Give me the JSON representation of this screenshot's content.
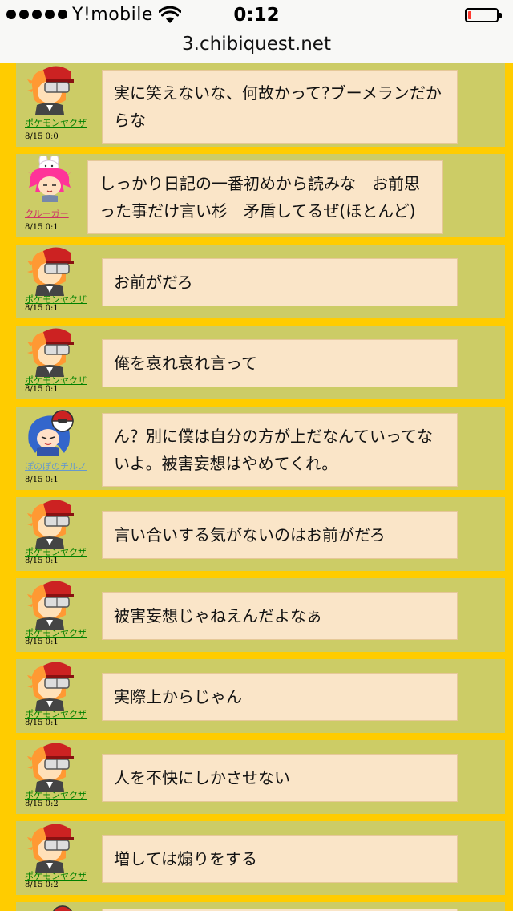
{
  "status_bar": {
    "carrier": "Y!mobile",
    "time": "0:12",
    "battery_level": 0.12,
    "battery_color": "#ff3a30"
  },
  "url_bar": {
    "url": "3.chibiquest.net"
  },
  "theme": {
    "page_bg": "#ffcc00",
    "row_bg": "#cccc66",
    "bubble_bg": "#fae5c8"
  },
  "messages": [
    {
      "user": "ポケモンヤクザ",
      "user_color": "#008000",
      "time": "8/15 0:0",
      "text": "実に笑えないな、何故かって?ブーメランだからな",
      "avatar": "pokemon-yakuza-avatar-icon"
    },
    {
      "user": "クルーガー",
      "user_color": "#cc3366",
      "time": "8/15 0:1",
      "text": "しっかり日記の一番初めから読みな　お前思った事だけ言い杉　矛盾してるぜ(ほとんど)",
      "avatar": "kruger-avatar-icon"
    },
    {
      "user": "ポケモンヤクザ",
      "user_color": "#008000",
      "time": "8/15 0:1",
      "text": "お前がだろ",
      "avatar": "pokemon-yakuza-avatar-icon"
    },
    {
      "user": "ポケモンヤクザ",
      "user_color": "#008000",
      "time": "8/15 0:1",
      "text": "俺を哀れ哀れ言って",
      "avatar": "pokemon-yakuza-avatar-icon"
    },
    {
      "user": "ぽのぽのチルノ",
      "user_color": "#6699cc",
      "time": "8/15 0:1",
      "text": "ん？別に僕は自分の方が上だなんていってないよ。被害妄想はやめてくれ。",
      "avatar": "cirno-avatar-icon"
    },
    {
      "user": "ポケモンヤクザ",
      "user_color": "#008000",
      "time": "8/15 0:1",
      "text": "言い合いする気がないのはお前がだろ",
      "avatar": "pokemon-yakuza-avatar-icon"
    },
    {
      "user": "ポケモンヤクザ",
      "user_color": "#008000",
      "time": "8/15 0:1",
      "text": "被害妄想じゃねえんだよなぁ",
      "avatar": "pokemon-yakuza-avatar-icon"
    },
    {
      "user": "ポケモンヤクザ",
      "user_color": "#008000",
      "time": "8/15 0:1",
      "text": "実際上からじゃん",
      "avatar": "pokemon-yakuza-avatar-icon"
    },
    {
      "user": "ポケモンヤクザ",
      "user_color": "#008000",
      "time": "8/15 0:2",
      "text": "人を不快にしかさせない",
      "avatar": "pokemon-yakuza-avatar-icon"
    },
    {
      "user": "ポケモンヤクザ",
      "user_color": "#008000",
      "time": "8/15 0:2",
      "text": "増しては煽りをする",
      "avatar": "pokemon-yakuza-avatar-icon"
    }
  ]
}
